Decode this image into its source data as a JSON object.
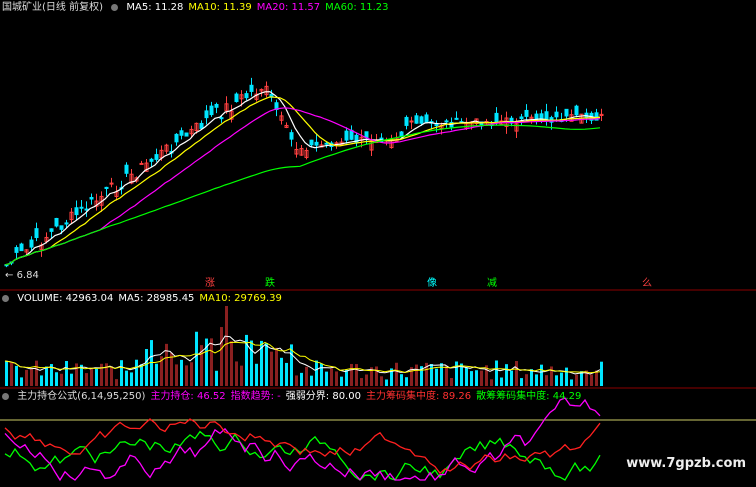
{
  "price_panel": {
    "title": "国城矿业(日线 前复权)",
    "indicators": [
      {
        "label": "MA5: 11.28",
        "color": "#ffffff"
      },
      {
        "label": "MA10: 11.39",
        "color": "#ffff00"
      },
      {
        "label": "MA20: 11.57",
        "color": "#ff00ff"
      },
      {
        "label": "MA60: 11.23",
        "color": "#00ff00"
      }
    ],
    "low_label": "6.84"
  },
  "volume_panel": {
    "indicators": [
      {
        "label": "VOLUME: 42963.04",
        "color": "#ffffff"
      },
      {
        "label": "MA5: 28985.45",
        "color": "#ffffff"
      },
      {
        "label": "MA10: 29769.39",
        "color": "#ffff00"
      }
    ]
  },
  "formula_panel": {
    "indicators": [
      {
        "label": "主力持仓公式(6,14,95,250)",
        "color": "#dddddd"
      },
      {
        "label": "主力持仓: 46.52",
        "color": "#ff00ff"
      },
      {
        "label": "指数趋势: -",
        "color": "#ff00ff"
      },
      {
        "label": "强弱分界: 80.00",
        "color": "#ffffff"
      },
      {
        "label": "主力筹码集中度: 89.26",
        "color": "#ff3030"
      },
      {
        "label": "散筹筹码集中度: 44.29",
        "color": "#00ff00"
      }
    ]
  },
  "signals": [
    {
      "text": "涨",
      "color": "#ff4040"
    },
    {
      "text": "跌",
      "color": "#00ff00"
    },
    {
      "text": "像",
      "color": "#00ffff"
    },
    {
      "text": "减",
      "color": "#00ff00"
    },
    {
      "text": "么",
      "color": "#ff4040"
    }
  ],
  "watermark": "www.7gpzb.com",
  "chart_data": {
    "type": "candlestick",
    "description_series": [
      {
        "name": "MA5"
      },
      {
        "name": "MA10"
      },
      {
        "name": "MA20"
      },
      {
        "name": "MA60"
      }
    ],
    "price_range": [
      6.84,
      16.3
    ],
    "min_low": 6.84,
    "volume_ma": {
      "MA5": 28985.45,
      "MA10": 29769.39,
      "last": 42963.04
    },
    "formula_threshold": 80.0
  }
}
